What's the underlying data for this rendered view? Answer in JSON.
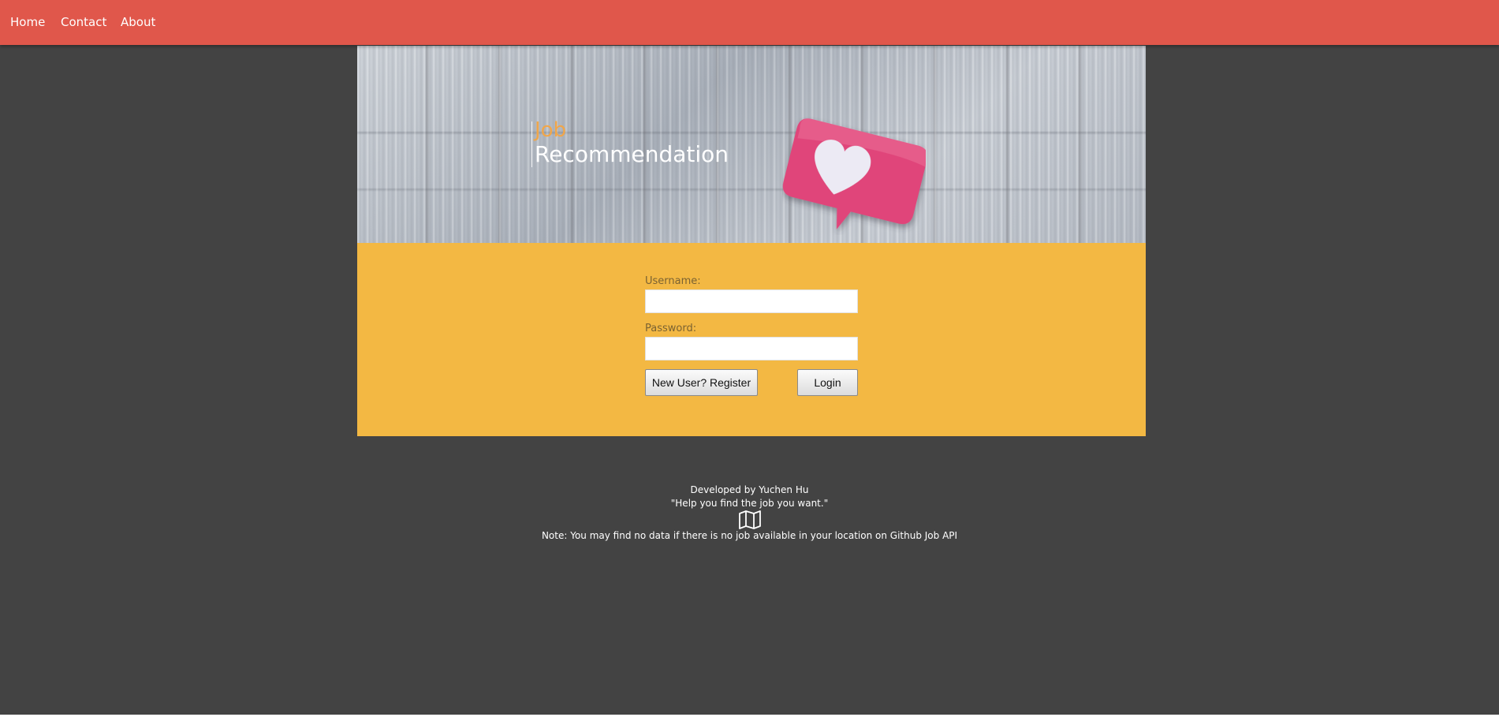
{
  "nav": {
    "items": [
      {
        "label": "Home"
      },
      {
        "label": "Contact"
      },
      {
        "label": "About"
      }
    ]
  },
  "hero": {
    "title_top": "Job",
    "title_bottom": "Recommendation",
    "image_icon": "heart-speech-bubble-icon"
  },
  "login": {
    "username_label": "Username:",
    "username_value": "",
    "password_label": "Password:",
    "password_value": "",
    "register_label": "New User? Register",
    "login_label": "Login"
  },
  "footer": {
    "developer": "Developed by Yuchen Hu",
    "tagline": "\"Help you find the job you want.\"",
    "icon": "map-icon",
    "note": "Note: You may find no data if there is no job available in your location on Github Job API"
  },
  "colors": {
    "nav_bg": "#e0574b",
    "page_bg": "#434343",
    "panel_bg": "#f3b843",
    "title_accent": "#f0a64a",
    "heart_bubble": "#e0457a"
  }
}
